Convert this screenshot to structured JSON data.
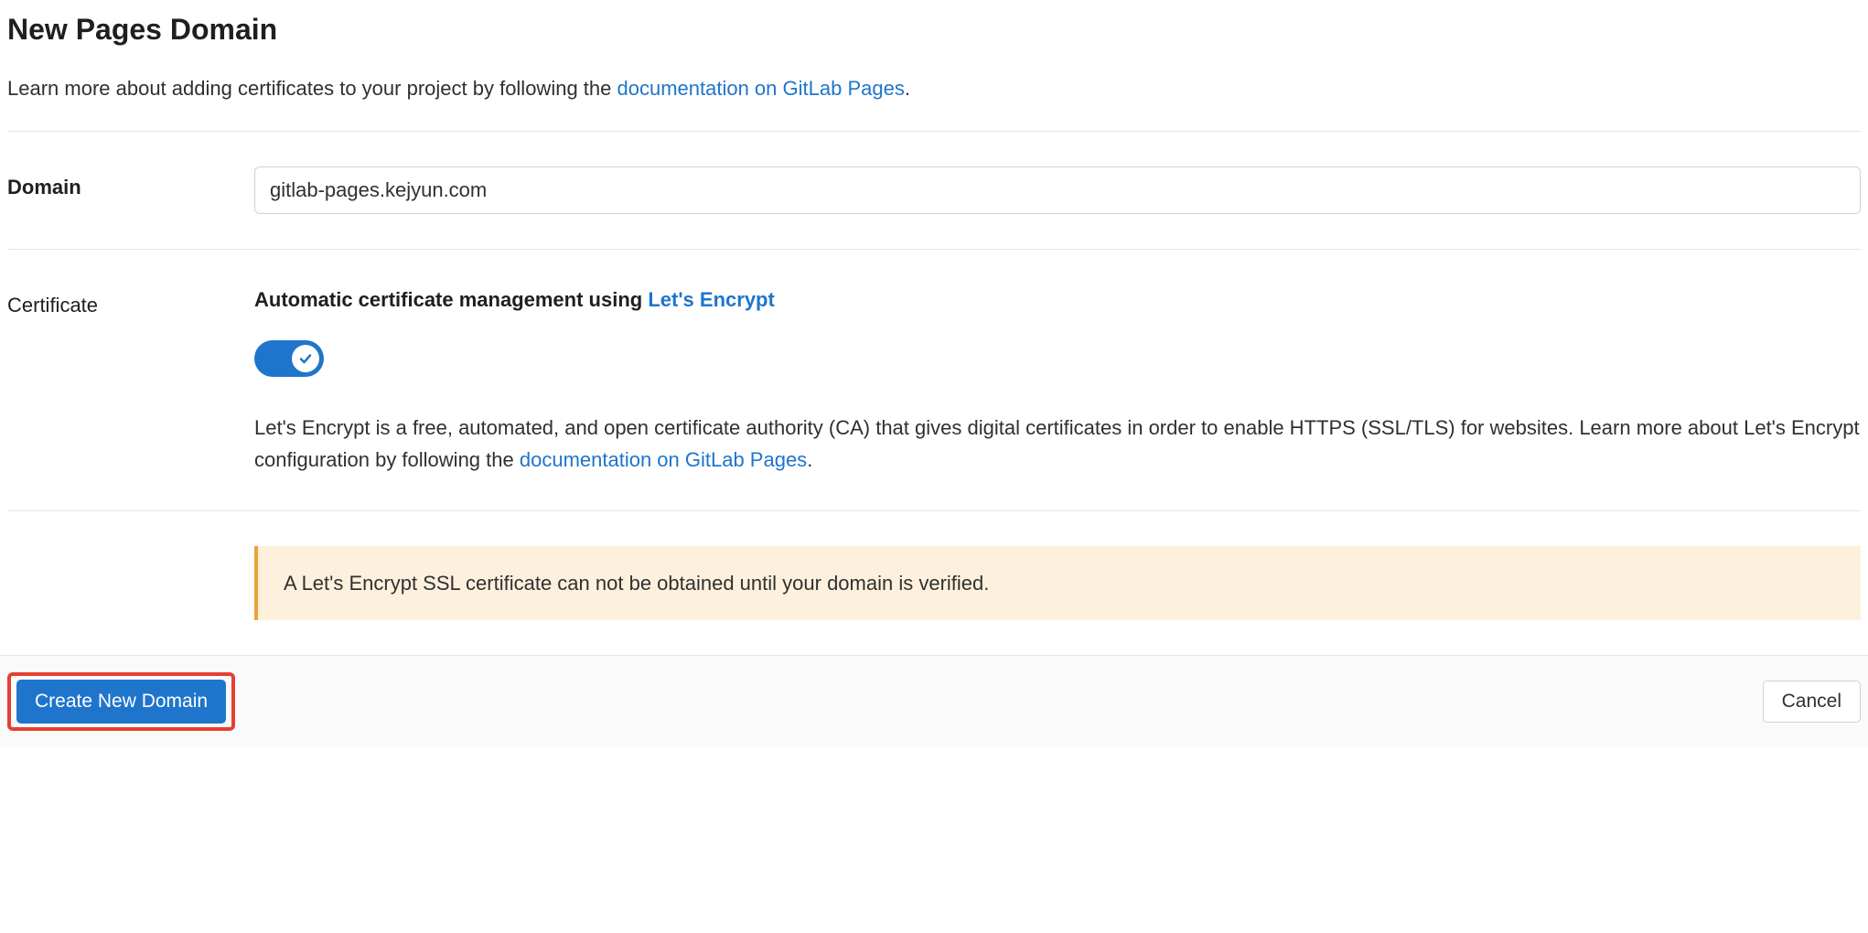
{
  "page": {
    "title": "New Pages Domain",
    "intro_text_prefix": "Learn more about adding certificates to your project by following the ",
    "intro_link": "documentation on GitLab Pages",
    "intro_text_suffix": "."
  },
  "domain": {
    "label": "Domain",
    "value": "gitlab-pages.kejyun.com"
  },
  "certificate": {
    "label": "Certificate",
    "heading_prefix": "Automatic certificate management using ",
    "heading_link": "Let's Encrypt",
    "toggle_on": true,
    "description_prefix": "Let's Encrypt is a free, automated, and open certificate authority (CA) that gives digital certificates in order to enable HTTPS (SSL/TLS) for websites. Learn more about Let's Encrypt configuration by following the ",
    "description_link": "documentation on GitLab Pages",
    "description_suffix": "."
  },
  "alert": {
    "message": "A Let's Encrypt SSL certificate can not be obtained until your domain is verified."
  },
  "buttons": {
    "create": "Create New Domain",
    "cancel": "Cancel"
  },
  "colors": {
    "link": "#1f75cb",
    "primary": "#1f75cb",
    "alert_bg": "#fdf1dd",
    "alert_border": "#e9a33a",
    "highlight": "#e54030"
  }
}
